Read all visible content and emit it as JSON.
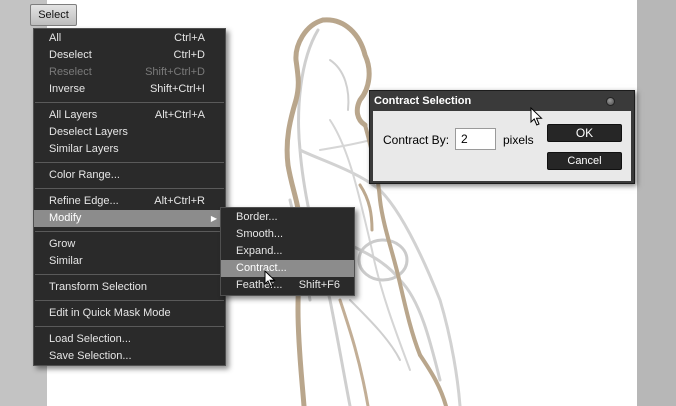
{
  "toolbar": {
    "select_button": "Select"
  },
  "menu": {
    "groups": [
      [
        {
          "label": "All",
          "shortcut": "Ctrl+A"
        },
        {
          "label": "Deselect",
          "shortcut": "Ctrl+D"
        },
        {
          "label": "Reselect",
          "shortcut": "Shift+Ctrl+D",
          "disabled": true
        },
        {
          "label": "Inverse",
          "shortcut": "Shift+Ctrl+I"
        }
      ],
      [
        {
          "label": "All Layers",
          "shortcut": "Alt+Ctrl+A"
        },
        {
          "label": "Deselect Layers",
          "shortcut": ""
        },
        {
          "label": "Similar Layers",
          "shortcut": ""
        }
      ],
      [
        {
          "label": "Color Range...",
          "shortcut": ""
        }
      ],
      [
        {
          "label": "Refine Edge...",
          "shortcut": "Alt+Ctrl+R"
        },
        {
          "label": "Modify",
          "shortcut": "",
          "submenu": true,
          "highlighted": true
        }
      ],
      [
        {
          "label": "Grow",
          "shortcut": ""
        },
        {
          "label": "Similar",
          "shortcut": ""
        }
      ],
      [
        {
          "label": "Transform Selection",
          "shortcut": ""
        }
      ],
      [
        {
          "label": "Edit in Quick Mask Mode",
          "shortcut": ""
        }
      ],
      [
        {
          "label": "Load Selection...",
          "shortcut": ""
        },
        {
          "label": "Save Selection...",
          "shortcut": ""
        }
      ]
    ],
    "submenu_arrow": "▶"
  },
  "modify_submenu": {
    "items": [
      {
        "label": "Border...",
        "shortcut": ""
      },
      {
        "label": "Smooth...",
        "shortcut": ""
      },
      {
        "label": "Expand...",
        "shortcut": ""
      },
      {
        "label": "Contract...",
        "shortcut": "",
        "highlighted": true
      },
      {
        "label": "Feather...",
        "shortcut": "Shift+F6"
      }
    ]
  },
  "dialog": {
    "title": "Contract Selection",
    "contract_by_label": "Contract By:",
    "contract_by_value": "2",
    "units": "pixels",
    "ok_label": "OK",
    "cancel_label": "Cancel"
  },
  "colors": {
    "menu_bg": "#2a2a2a",
    "menu_highlight": "#8c8c8c",
    "dialog_body": "#e9e9e9",
    "sketch_brown": "#b8a48a",
    "sketch_gray": "#c9c9c9"
  }
}
